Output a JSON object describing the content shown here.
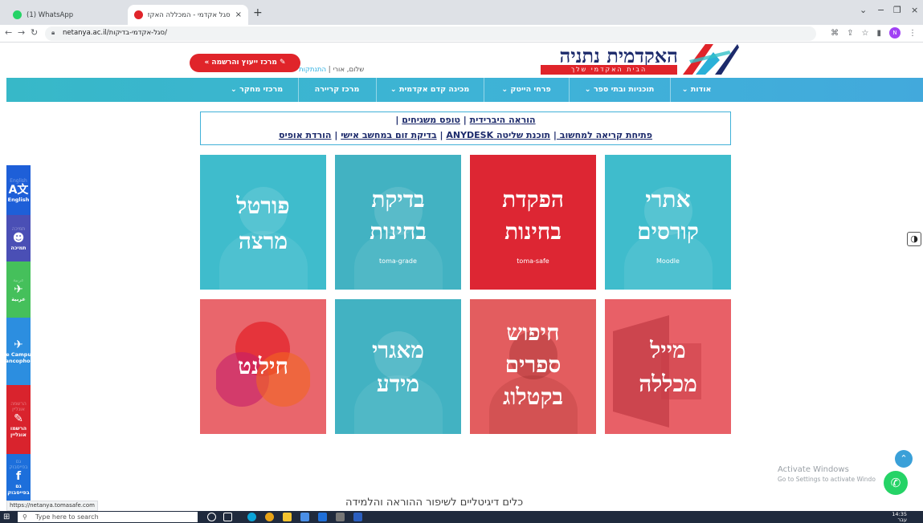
{
  "browser": {
    "tabs": [
      {
        "title": "(1) WhatsApp",
        "favicon_color": "#25d366"
      },
      {
        "title": "סגל אקדמי - המכללה האקדמית נ",
        "favicon_color": "#e0242a"
      }
    ],
    "new_tab": "+",
    "url": "netanya.ac.il/סגל-אקדמי-בדיקות/",
    "window_controls": {
      "minimize": "−",
      "restore": "❐",
      "close": "×",
      "chevron": "⌄"
    },
    "profile_initial": "N"
  },
  "header": {
    "logo_title": "האקדמית נתניה",
    "logo_subtitle": "הבית האקדמי שלך",
    "greeting_name": "שלום, אורי",
    "logout_label": "התנתקות",
    "register_button": "✎ מרכז ייעוץ והרשמה »"
  },
  "nav": [
    {
      "label": "אודות ⌄"
    },
    {
      "label": "תוכניות ובתי ספר ⌄"
    },
    {
      "label": "פרחי הייטק ⌄"
    },
    {
      "label": "מכינה קדם אקדמית ⌄"
    },
    {
      "label": "מרכז קריירה"
    },
    {
      "label": "מרכזי מחקר ⌄"
    }
  ],
  "links": {
    "row1": {
      "link1": "הוראה היברידית",
      "sep": " | ",
      "link2": "טופס משגיחים",
      "tail": " |"
    },
    "row2": {
      "link1": "פתיחת קריאה למחשוב ",
      "link2": "תוכנת שליטה ANYDESK",
      "link3": "בדיקת זום במחשב אישי",
      "link4": "הורדת אופיס",
      "sep": " | "
    }
  },
  "tiles": [
    {
      "line1": "אתרי",
      "line2": "קורסים",
      "line3": "",
      "sub": "Moodle"
    },
    {
      "line1": "הפקדת",
      "line2": "בחינות",
      "line3": "",
      "sub": "toma-safe"
    },
    {
      "line1": "בדיקת",
      "line2": "בחינות",
      "line3": "",
      "sub": "toma-grade"
    },
    {
      "line1": "פורטל",
      "line2": "מרצה",
      "line3": "",
      "sub": ""
    },
    {
      "line1": "מייל",
      "line2": "מכללה",
      "line3": "",
      "sub": ""
    },
    {
      "line1": "חיפוש",
      "line2": "ספרים",
      "line3": "בקטלוג",
      "sub": ""
    },
    {
      "line1": "מאגרי",
      "line2": "מידע",
      "line3": "",
      "sub": ""
    },
    {
      "line1": "חילנט",
      "line2": "",
      "line3": "",
      "sub": ""
    }
  ],
  "sidebar": [
    {
      "faint": "English",
      "icon": "A文",
      "label": "English",
      "color": "#1e5fd8"
    },
    {
      "faint": "תמיכה",
      "icon": "☻",
      "label": "תמיכה",
      "color": "#4a4fb5"
    },
    {
      "faint": "عربية",
      "icon": "✈",
      "label": "عربية",
      "color": "#45c05b"
    },
    {
      "faint": "",
      "icon": "✈",
      "label": "Le Campus Francophone",
      "color": "#2c8ee0"
    },
    {
      "faint": "הרשמה אונליין",
      "icon": "✎",
      "label": "הרשמו אונליין",
      "color": "#d9232d"
    },
    {
      "faint": "גם בפייסבוק",
      "icon": "f",
      "label": "גם בפייסבוק",
      "color": "#1d6fdb"
    }
  ],
  "contrast_icon": "◑",
  "scroll_up_icon": "⌃",
  "whatsapp_icon": "✆",
  "watermark": {
    "line1": "Activate Windows",
    "line2": "Go to Settings to activate Windo"
  },
  "bottom_heading": "כלים דיגיטליים לשיפור ההוראה והלמידה",
  "status_url": "https://netanya.tomasafe.com",
  "taskbar": {
    "search_placeholder": "Type here to search",
    "time": "14:35",
    "lang": "עבר"
  }
}
